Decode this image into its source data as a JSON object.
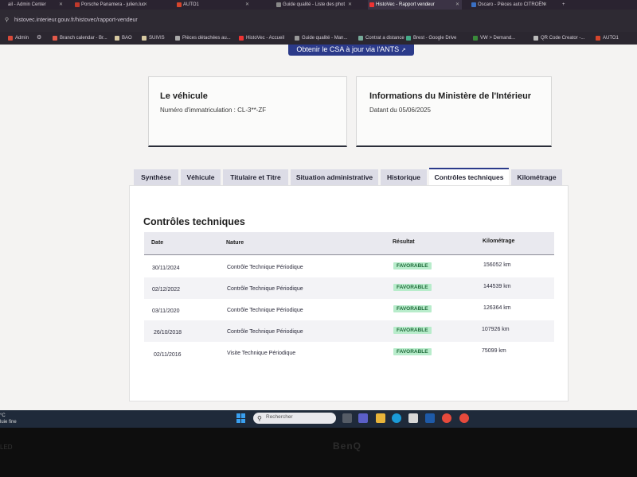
{
  "browser": {
    "tabs": [
      {
        "label": "ail - Admin Center",
        "active": false
      },
      {
        "label": "Porsche Panamera - julien.luc",
        "active": false
      },
      {
        "label": "AUTO1",
        "active": false
      },
      {
        "label": "Guide qualité - Liste des phot",
        "active": false
      },
      {
        "label": "HistoVec - Rapport vendeur",
        "active": true
      },
      {
        "label": "Oscaro - Pièces auto CITROËN",
        "active": false
      }
    ],
    "new_tab": "+",
    "url": "histovec.interieur.gouv.fr/histovec/rapport-vendeur",
    "bookmarks": [
      "Admin",
      "Branch calendar - Br...",
      "BAO",
      "SUIVIS",
      "Pièces détachées au...",
      "HistoVec - Accueil",
      "Guide qualité - Man...",
      "Contrat a distance",
      "Brest - Google Drive",
      "VW > Demand...",
      "QR Code Creator -...",
      "AUTO1"
    ]
  },
  "page": {
    "csa_banner": "Obtenir le CSA à jour via l'ANTS",
    "vehicle_card": {
      "title": "Le véhicule",
      "plate_label": "Numéro d'immatriculation : CL-3**-ZF"
    },
    "ministry_card": {
      "title": "Informations du Ministère de l'Intérieur",
      "date_text": "Datant du 05/06/2025"
    },
    "tabs": [
      {
        "label": "Synthèse",
        "active": false
      },
      {
        "label": "Véhicule",
        "active": false
      },
      {
        "label": "Titulaire et Titre",
        "active": false
      },
      {
        "label": "Situation administrative",
        "active": false
      },
      {
        "label": "Historique",
        "active": false
      },
      {
        "label": "Contrôles techniques",
        "active": true
      },
      {
        "label": "Kilométrage",
        "active": false
      }
    ],
    "section_title": "Contrôles techniques",
    "table": {
      "headers": [
        "Date",
        "Nature",
        "Résultat",
        "Kilométrage"
      ],
      "rows": [
        {
          "date": "30/11/2024",
          "nature": "Contrôle Technique Périodique",
          "result": "FAVORABLE",
          "km": "156052 km"
        },
        {
          "date": "02/12/2022",
          "nature": "Contrôle Technique Périodique",
          "result": "FAVORABLE",
          "km": "144539 km"
        },
        {
          "date": "03/11/2020",
          "nature": "Contrôle Technique Périodique",
          "result": "FAVORABLE",
          "km": "126364 km"
        },
        {
          "date": "26/10/2018",
          "nature": "Contrôle Technique Périodique",
          "result": "FAVORABLE",
          "km": "107926 km"
        },
        {
          "date": "02/11/2016",
          "nature": "Visite Technique Périodique",
          "result": "FAVORABLE",
          "km": "75099 km"
        }
      ]
    }
  },
  "taskbar": {
    "weather_line1": "°C",
    "weather_line2": "luie fine",
    "search_placeholder": "Rechercher"
  },
  "monitor": {
    "brand": "BenQ",
    "model": "LED"
  },
  "colors": {
    "accent": "#2b3a8a",
    "badge_bg": "#b8eccb",
    "badge_text": "#1f6b3a"
  }
}
